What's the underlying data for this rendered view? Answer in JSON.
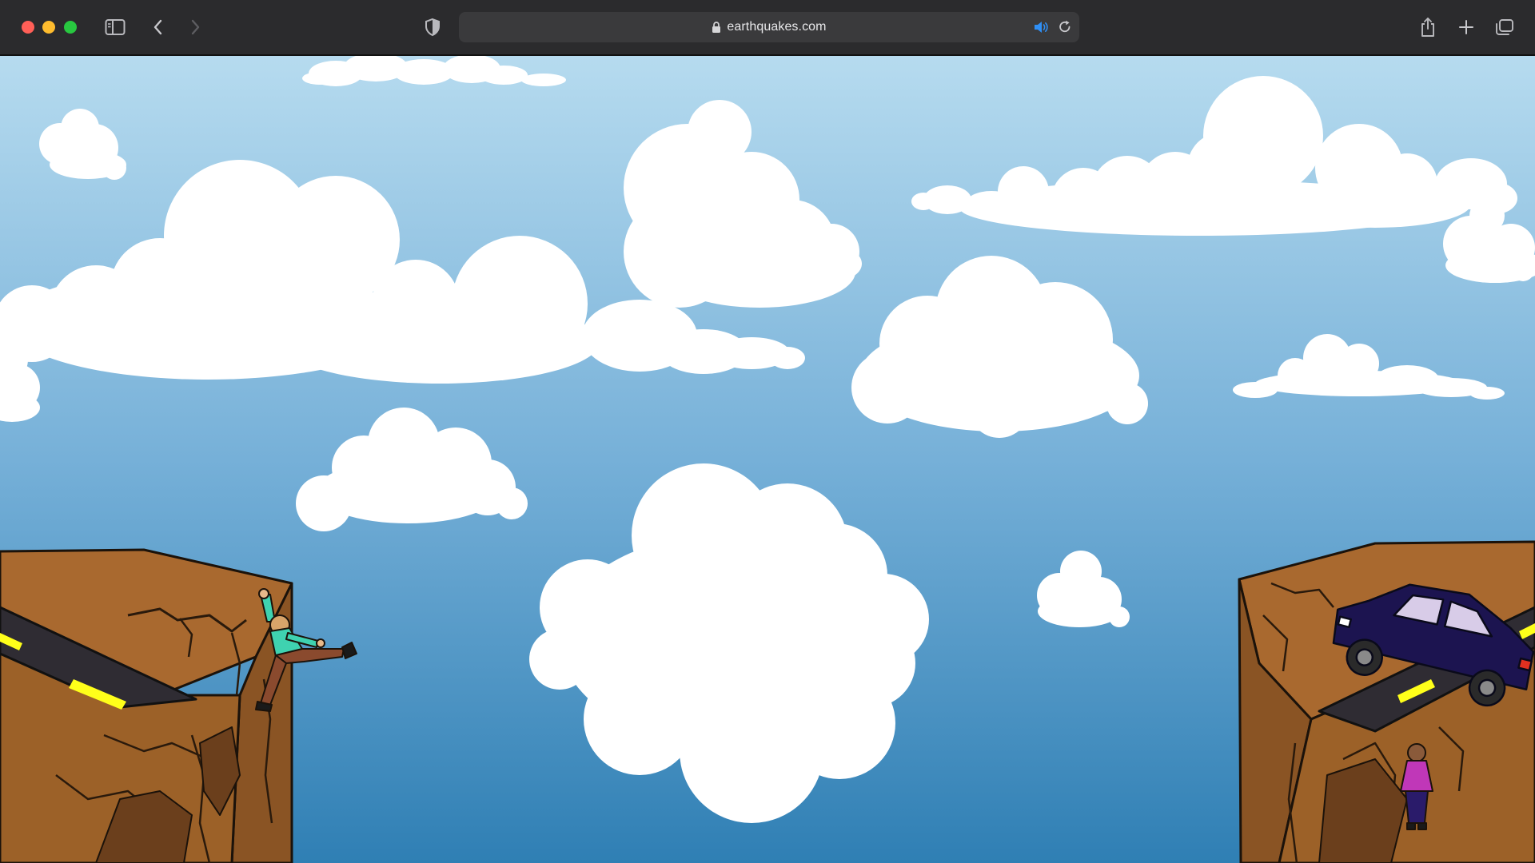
{
  "browser": {
    "url": "earthquakes.com",
    "icons": {
      "close": "close-window",
      "minimize": "minimize-window",
      "zoom": "zoom-window",
      "sidebar": "sidebar-icon",
      "back": "chevron-left-icon",
      "forward": "chevron-right-icon",
      "privacy": "shield-icon",
      "lock": "lock-icon",
      "audio": "speaker-icon",
      "reload": "reload-icon",
      "share": "share-icon",
      "new_tab": "plus-icon",
      "tabs": "tabs-overview-icon"
    },
    "colors": {
      "toolbar": "#2b2b2d",
      "address_bar": "#3a3a3c",
      "audio_accent": "#2f8ff5"
    }
  },
  "scene": {
    "colors": {
      "sky_top": "#b6dbef",
      "sky_bottom": "#2f7fb4",
      "cloud": "#ffffff",
      "cliff": "#a9692f",
      "cliff_dark": "#6b3f1c",
      "road": "#2f2c33",
      "road_line": "#ffff1a",
      "car": "#1c1450",
      "climber_shirt": "#3fd2b0",
      "climber_pants": "#8a4a2e",
      "girl_coat": "#c037b8"
    },
    "objects": [
      "clouds",
      "left-cliff",
      "right-cliff",
      "road",
      "hanging-climber",
      "falling-car",
      "standing-girl"
    ]
  }
}
